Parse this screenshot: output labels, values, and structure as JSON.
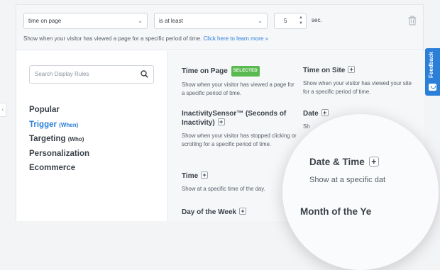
{
  "condition": {
    "rule_select": "time on page",
    "operator_select": "is at least",
    "value": "5",
    "unit": "sec.",
    "helper_text": "Show when your visitor has viewed a page for a specific period of time.",
    "helper_link": "Click here to learn more »"
  },
  "sidebar": {
    "search_placeholder": "Search Display Rules",
    "items": [
      {
        "label": "Popular",
        "sub": ""
      },
      {
        "label": "Trigger",
        "sub": "(When)"
      },
      {
        "label": "Targeting",
        "sub": "(Who)"
      },
      {
        "label": "Personalization",
        "sub": ""
      },
      {
        "label": "Ecommerce",
        "sub": ""
      }
    ]
  },
  "rules": {
    "time_on_page": {
      "title": "Time on Page",
      "badge": "SELECTED",
      "desc": "Show when your visitor has viewed a page for a specific period of time."
    },
    "time_on_site": {
      "title": "Time on Site",
      "desc": "Show when your visitor has viewed your site for a specific period of time."
    },
    "inactivity": {
      "title": "InactivitySensor™ (Seconds of Inactivity)",
      "desc": "Show when your visitor has stopped clicking or scrolling for a specific period of time."
    },
    "date": {
      "title": "Date",
      "desc": "Sh"
    },
    "time": {
      "title": "Time",
      "desc": "Show at a specific time of the day."
    },
    "day_of_week": {
      "title": "Day of the Week"
    },
    "plus_symbol": "+"
  },
  "zoom": {
    "title": "Date & Time",
    "desc": "Show at a specific dat",
    "bottom": "Month of the Ye"
  },
  "feedback": {
    "label": "Feedback"
  },
  "colors": {
    "accent": "#2b7fd9",
    "selected_badge": "#5ab950"
  }
}
